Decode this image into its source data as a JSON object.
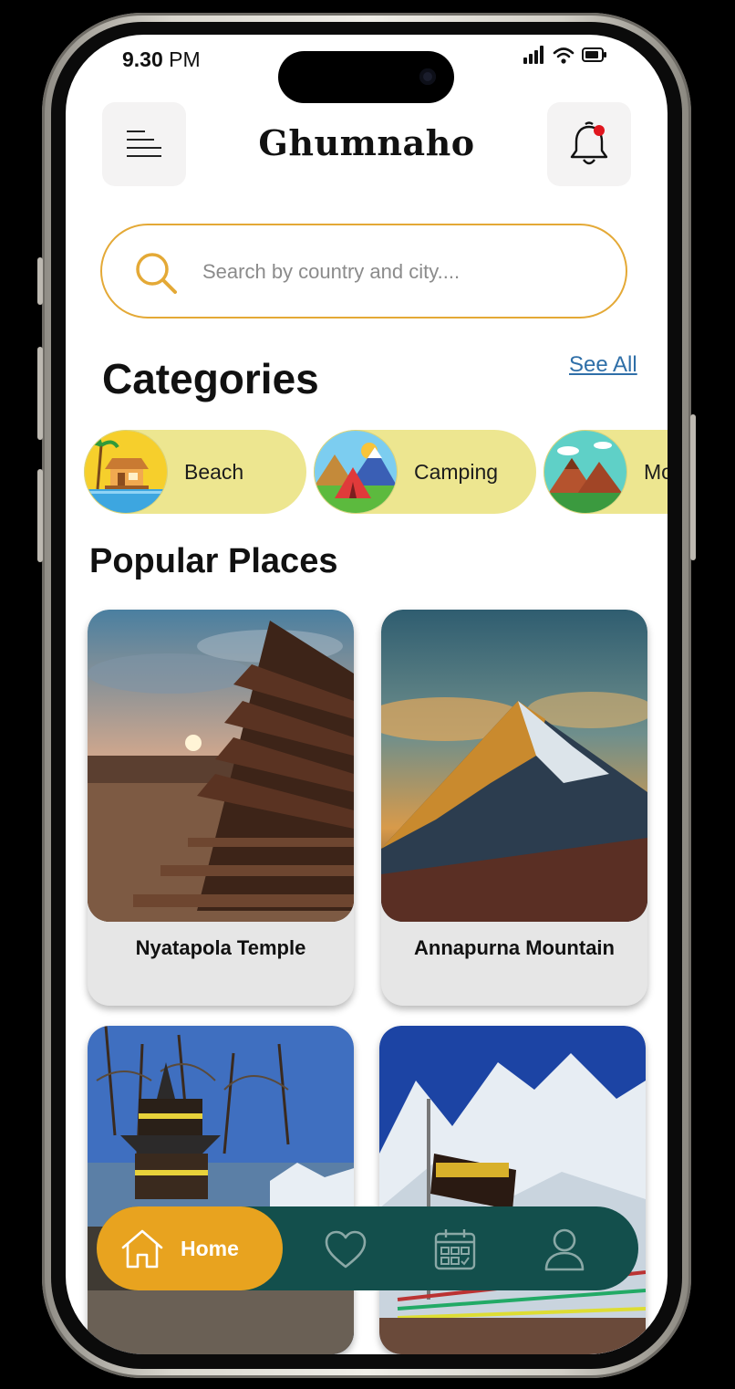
{
  "status_bar": {
    "time": "9.30",
    "period": "PM"
  },
  "header": {
    "title": "Ghumnaho",
    "menu_icon": "menu-icon",
    "bell_icon": "bell-icon",
    "notification_color": "#e0161e"
  },
  "search": {
    "placeholder": "Search by country and city....",
    "value": "",
    "accent": "#e4a936"
  },
  "categories": {
    "title": "Categories",
    "see_all": "See All",
    "items": [
      {
        "label": "Beach",
        "icon": "beach-icon"
      },
      {
        "label": "Camping",
        "icon": "camping-icon"
      },
      {
        "label": "Mo",
        "icon": "mountain-icon"
      }
    ],
    "chip_color": "#ede690"
  },
  "popular": {
    "title": "Popular Places",
    "places": [
      {
        "name": "Nyatapola Temple"
      },
      {
        "name": "Annapurna Mountain"
      },
      {
        "name": ""
      },
      {
        "name": ""
      }
    ]
  },
  "bottom_nav": {
    "home_label": "Home",
    "items": [
      "home-icon",
      "heart-icon",
      "calendar-icon",
      "profile-icon"
    ],
    "bar_color": "#134f4c",
    "active_color": "#e8a31f"
  }
}
